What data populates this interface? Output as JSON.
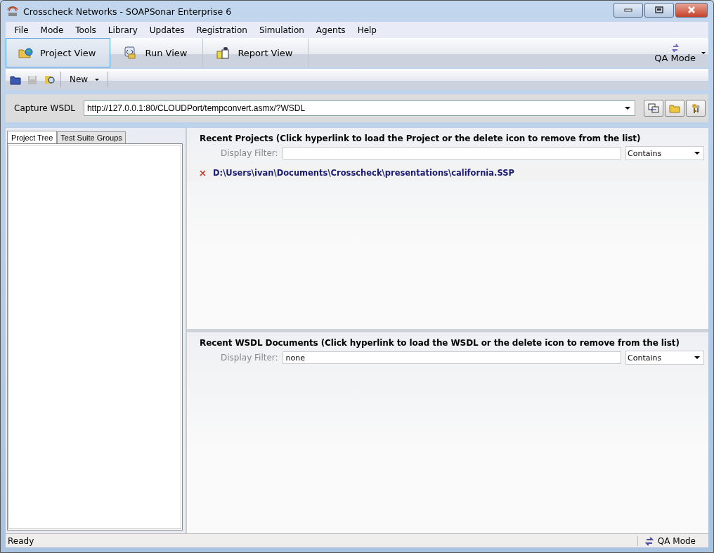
{
  "window": {
    "title": "Crosscheck Networks - SOAPSonar Enterprise 6"
  },
  "menu": [
    {
      "label": "File"
    },
    {
      "label": "Mode"
    },
    {
      "label": "Tools"
    },
    {
      "label": "Library"
    },
    {
      "label": "Updates"
    },
    {
      "label": "Registration"
    },
    {
      "label": "Simulation"
    },
    {
      "label": "Agents"
    },
    {
      "label": "Help"
    }
  ],
  "views": [
    {
      "label": "Project View",
      "selected": true
    },
    {
      "label": "Run View",
      "selected": false
    },
    {
      "label": "Report View",
      "selected": false
    }
  ],
  "mode_button": {
    "label": "QA Mode"
  },
  "toolbar": {
    "new_label": "New"
  },
  "capture": {
    "label": "Capture WSDL",
    "value": "http://127.0.0.1:80/CLOUDPort/tempconvert.asmx/?WSDL"
  },
  "left_tabs": [
    {
      "label": "Project Tree",
      "selected": true
    },
    {
      "label": "Test Suite Groups",
      "selected": false
    }
  ],
  "recent_projects": {
    "heading": "Recent Projects (Click hyperlink to load the Project or the delete icon to remove from the list)",
    "filter_label": "Display Filter:",
    "match": "Contains",
    "items": [
      {
        "path": "D:\\Users\\ivan\\Documents\\Crosscheck\\presentations\\california.SSP"
      }
    ]
  },
  "recent_wsdl": {
    "heading": "Recent WSDL Documents (Click hyperlink to load the WSDL or the delete icon to remove from the list)",
    "filter_label": "Display Filter:",
    "filter_value": "none",
    "match": "Contains"
  },
  "status_bar": {
    "text": "Ready",
    "mode": "QA Mode"
  }
}
